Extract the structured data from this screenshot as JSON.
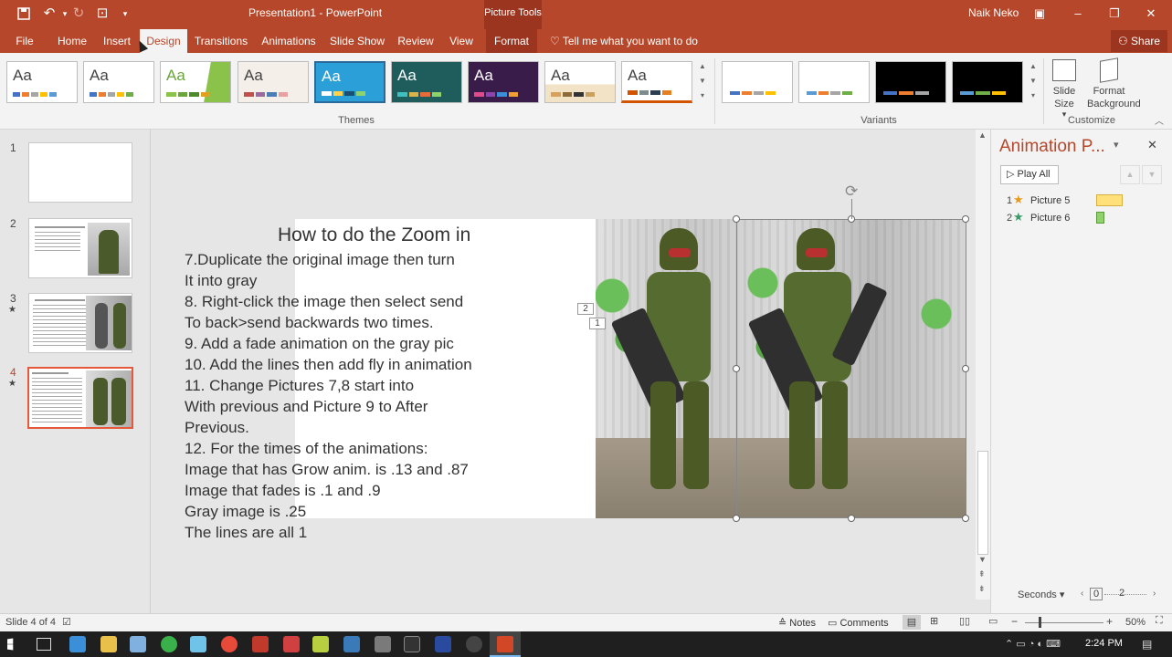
{
  "window": {
    "doc_title": "Presentation1 - PowerPoint",
    "context_tab": "Picture Tools",
    "user": "Naik Neko",
    "colors": {
      "accent": "#b7472a",
      "ribbon": "#f3f3f3",
      "workspace": "#e6e6e6"
    }
  },
  "tabs": [
    {
      "label": "File"
    },
    {
      "label": "Home"
    },
    {
      "label": "Insert"
    },
    {
      "label": "Design"
    },
    {
      "label": "Transitions"
    },
    {
      "label": "Animations"
    },
    {
      "label": "Slide Show"
    },
    {
      "label": "Review"
    },
    {
      "label": "View"
    },
    {
      "label": "Format"
    }
  ],
  "tell_me": "Tell me what you want to do",
  "share": "Share",
  "ribbon": {
    "theme_sample": "Aa",
    "themes_group": "Themes",
    "variants_group": "Variants",
    "customize_group": "Customize",
    "slide_size": "Slide Size",
    "slide_size_arrow": "▾",
    "format_bg_1": "Format",
    "format_bg_2": "Background"
  },
  "thumbnails": [
    {
      "num": "1",
      "star": ""
    },
    {
      "num": "2",
      "star": ""
    },
    {
      "num": "3",
      "star": "★"
    },
    {
      "num": "4",
      "star": "★"
    }
  ],
  "slide": {
    "title": "How to do the Zoom in",
    "lines": [
      "7.Duplicate the original image then turn",
      "It into gray",
      "8. Right-click the image then select send",
      "To back>send backwards two times.",
      "9. Add a fade animation on the gray pic",
      "10. Add the lines then add fly in animation",
      "11. Change Pictures 7,8 start into",
      "With previous and Picture 9 to After",
      "Previous.",
      "12. For the times of the animations:",
      "Image that has Grow anim. is .13 and .87",
      "Image that fades is .1 and .9",
      "Gray image is .25",
      "The lines are all 1"
    ],
    "tag_2": "2",
    "tag_1": "1"
  },
  "anim_pane": {
    "title": "Animation P...",
    "play_all": "Play All",
    "items": [
      {
        "num": "1",
        "name": "Picture 5",
        "bar_color": "#ffe07a"
      },
      {
        "num": "2",
        "name": "Picture 6",
        "bar_color": "#8fd16b"
      }
    ],
    "seconds": "Seconds",
    "timeline_start": "0",
    "timeline_mark": "2"
  },
  "status": {
    "slide_of": "Slide 4 of 4",
    "notes": "Notes",
    "comments": "Comments",
    "zoom": "50%"
  },
  "taskbar": {
    "time": "2:24 PM"
  }
}
